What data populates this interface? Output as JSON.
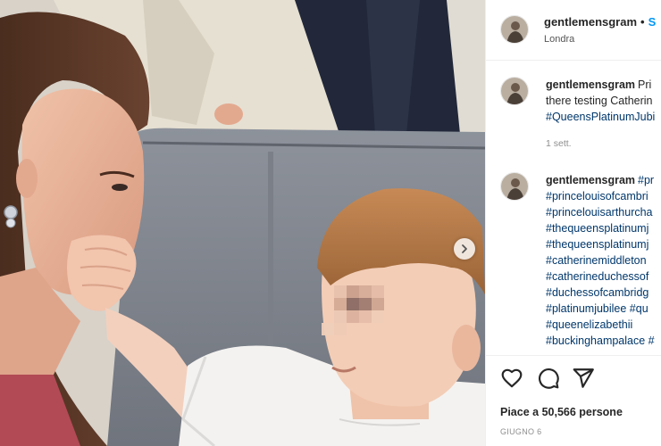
{
  "post": {
    "username": "gentlemensgram",
    "follow_label": "S",
    "location": "Londra"
  },
  "caption": {
    "username": "gentlemensgram",
    "line1": "Pri",
    "line2": "there testing Catherin",
    "line3": "#QueensPlatinumJubi",
    "time": "1 sett."
  },
  "comment": {
    "username": "gentlemensgram",
    "first_tag": "#pr",
    "hashtags": [
      "#princelouisofcambri",
      "#princelouisarthurcha",
      "#thequeensplatinumj",
      "#thequeensplatinumj",
      "#catherinemiddleton",
      "#catherineduchessof",
      "#duchessofcambridg",
      "#platinumjubilee #qu",
      "#queenelizabethii",
      "#buckinghampalace #"
    ]
  },
  "actions": {
    "like_icon": "heart-icon",
    "comment_icon": "comment-icon",
    "share_icon": "share-icon",
    "likes_text": "Piace a 50,566 persone",
    "date_text": "GIUGNO 6"
  },
  "photo": {
    "next_icon": "chevron-right-icon"
  },
  "colors": {
    "link": "#0095f6",
    "hashtag": "#00376b",
    "text": "#262626",
    "muted": "#8e8e8e"
  }
}
